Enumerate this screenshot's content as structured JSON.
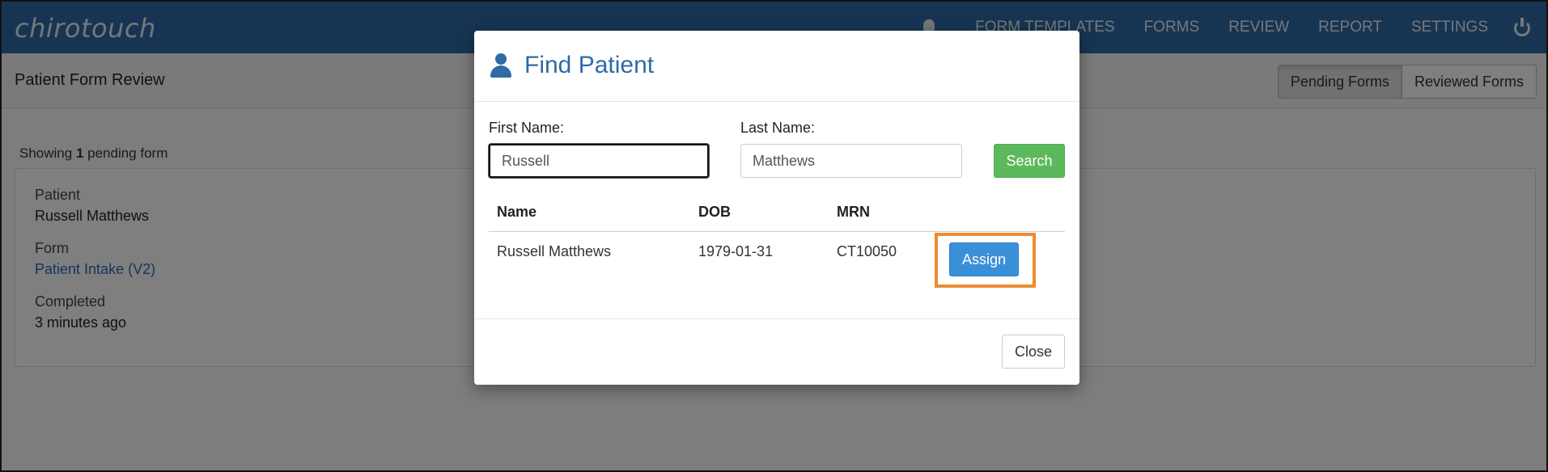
{
  "app": {
    "brand": "chirotouch"
  },
  "nav": {
    "items": [
      "FORM TEMPLATES",
      "FORMS",
      "REVIEW",
      "REPORT",
      "SETTINGS"
    ],
    "bell_icon": "bell-icon",
    "power_icon": "power-icon"
  },
  "header": {
    "title": "Patient Form Review",
    "tabs": [
      {
        "label": "Pending Forms",
        "active": true
      },
      {
        "label": "Reviewed Forms",
        "active": false
      }
    ]
  },
  "main": {
    "showing_prefix": "Showing ",
    "showing_count": "1",
    "showing_suffix": " pending form",
    "card": {
      "patient_label": "Patient",
      "patient_value": "Russell Matthews",
      "form_label": "Form",
      "form_value": "Patient Intake (V2)",
      "completed_label": "Completed",
      "completed_value": "3 minutes ago"
    }
  },
  "modal": {
    "title": "Find Patient",
    "icon": "user-icon",
    "first_name_label": "First Name:",
    "first_name_value": "Russell",
    "last_name_label": "Last Name:",
    "last_name_value": "Matthews",
    "search_button": "Search",
    "columns": [
      "Name",
      "DOB",
      "MRN"
    ],
    "results": [
      {
        "name": "Russell Matthews",
        "dob": "1979-01-31",
        "mrn": "CT10050",
        "action": "Assign"
      }
    ],
    "close_button": "Close"
  },
  "colors": {
    "navbar": "#2f6aa6",
    "accent": "#2f6aa6",
    "search_button": "#5cb85c",
    "assign_button": "#3a8fd9",
    "highlight": "#f08a32"
  }
}
